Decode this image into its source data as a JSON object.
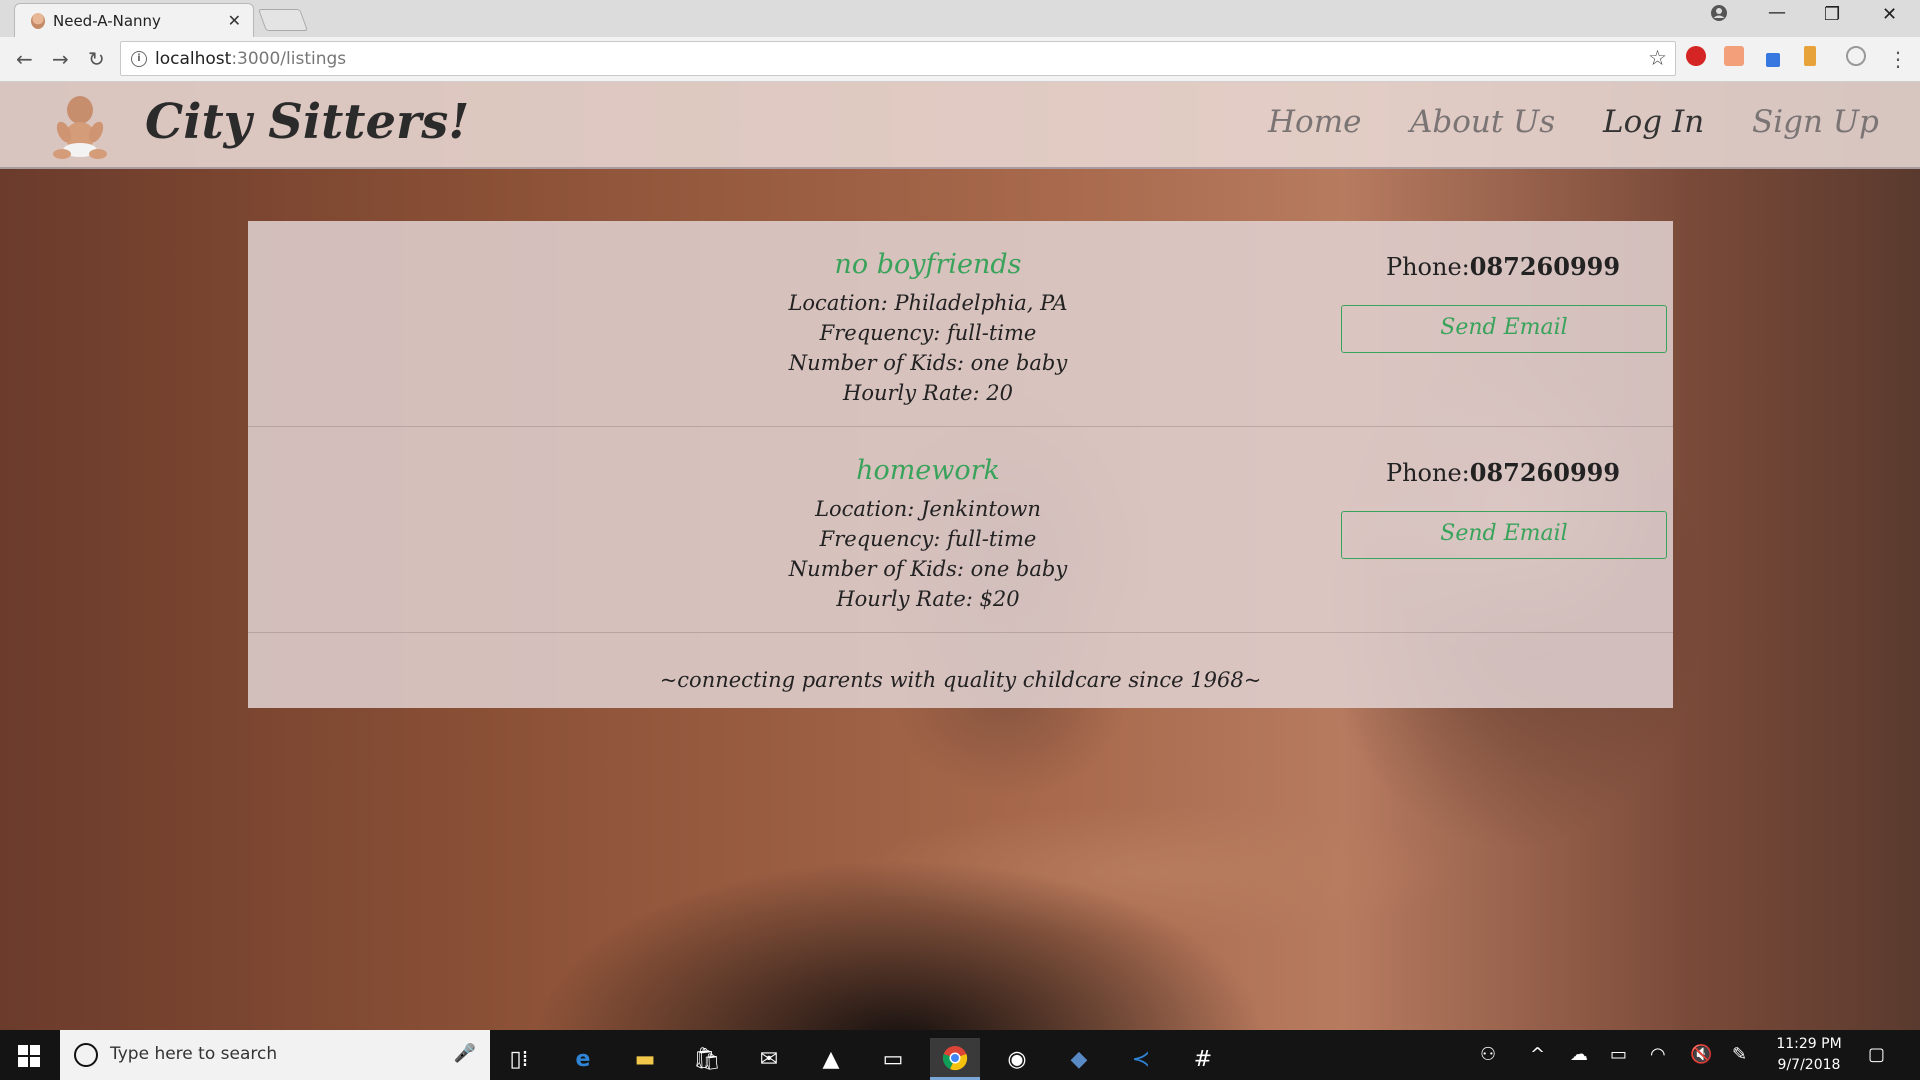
{
  "browser": {
    "tab_title": "Need-A-Nanny",
    "tab_close": "✕",
    "url_host": "localhost",
    "url_path": ":3000/listings",
    "icons": [
      "favicon-baby",
      "new-tab",
      "account-icon",
      "minimize-icon",
      "maximize-icon",
      "close-icon",
      "back-icon",
      "forward-icon",
      "reload-icon",
      "info-icon",
      "star-icon",
      "menu-icon"
    ]
  },
  "site": {
    "brand": "City Sitters!",
    "nav": {
      "home": "Home",
      "about": "About Us",
      "login": "Log In",
      "signup": "Sign Up"
    }
  },
  "listings": [
    {
      "title": "no boyfriends",
      "location": "Location: Philadelphia, PA",
      "frequency": "Frequency: full-time",
      "kids": "Number of Kids: one baby",
      "rate": "Hourly Rate: 20",
      "phone_label": "Phone:",
      "phone_number": "087260999",
      "button": "Send Email"
    },
    {
      "title": "homework",
      "location": "Location: Jenkintown",
      "frequency": "Frequency: full-time",
      "kids": "Number of Kids: one baby",
      "rate": "Hourly Rate: $20",
      "phone_label": "Phone:",
      "phone_number": "087260999",
      "button": "Send Email"
    }
  ],
  "tagline": "~connecting parents with quality childcare since 1968~",
  "taskbar": {
    "search_placeholder": "Type here to search",
    "time": "11:29 PM",
    "date": "9/7/2018"
  },
  "colors": {
    "accent_green": "#3aa35b",
    "header_bg": "#e8d8d4",
    "text_dark": "#222222"
  }
}
